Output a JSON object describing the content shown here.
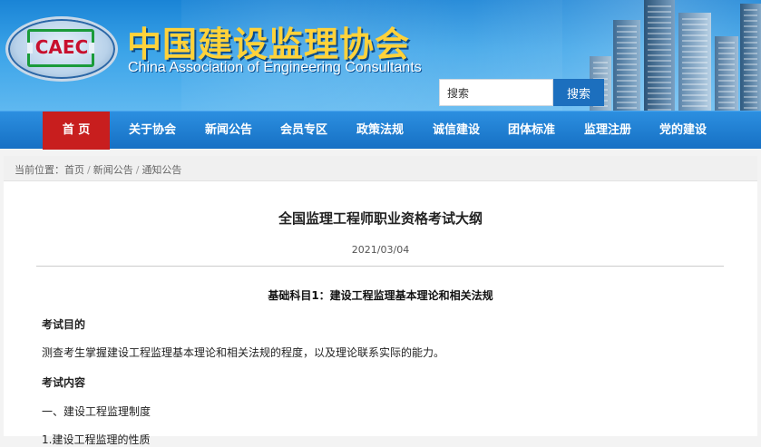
{
  "header": {
    "logo_text": "CAEC",
    "title_cn": "中国建设监理协会",
    "title_en": "China Association of Engineering Consultants",
    "search": {
      "value": "搜索",
      "button_label": "搜索"
    }
  },
  "nav": {
    "items": [
      {
        "label": "首 页",
        "active": true
      },
      {
        "label": "关于协会"
      },
      {
        "label": "新闻公告"
      },
      {
        "label": "会员专区"
      },
      {
        "label": "政策法规"
      },
      {
        "label": "诚信建设"
      },
      {
        "label": "团体标准"
      },
      {
        "label": "监理注册"
      },
      {
        "label": "党的建设"
      }
    ]
  },
  "breadcrumb": {
    "prefix": "当前位置：",
    "items": [
      "首页",
      "新闻公告",
      "通知公告"
    ],
    "separator": "/"
  },
  "article": {
    "title": "全国监理工程师职业资格考试大纲",
    "date": "2021/03/04",
    "subject": "基础科目1：建设工程监理基本理论和相关法规",
    "sections": [
      {
        "text": "考试目的",
        "bold": true
      },
      {
        "text": "测查考生掌握建设工程监理基本理论和相关法规的程度，以及理论联系实际的能力。",
        "bold": false
      },
      {
        "text": "考试内容",
        "bold": true
      },
      {
        "text": "一、建设工程监理制度",
        "bold": false
      },
      {
        "text": "1.建设工程监理的性质",
        "bold": false
      }
    ]
  },
  "colors": {
    "nav_bg": "#1670c4",
    "nav_active": "#c81e1e",
    "title_yellow": "#ffd23a",
    "logo_red": "#c8102e",
    "logo_green": "#1a9b3a"
  }
}
